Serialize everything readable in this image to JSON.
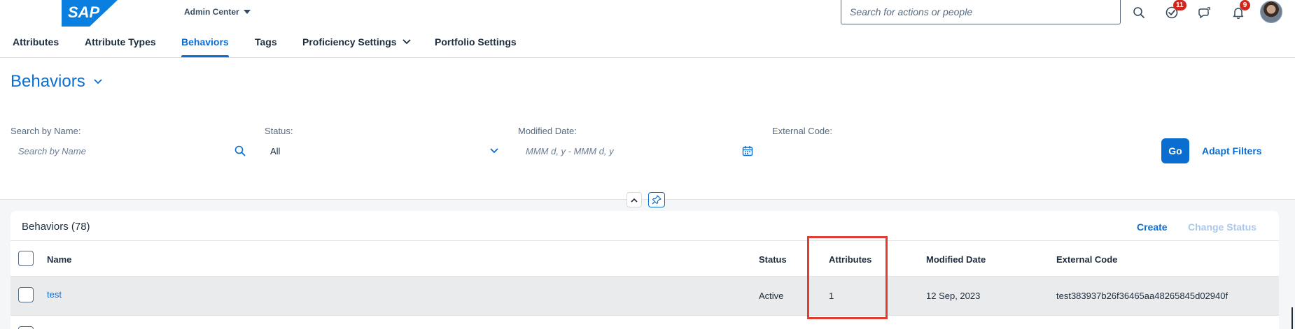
{
  "shell": {
    "logo_text": "SAP",
    "app_switcher_label": "Admin Center",
    "search_placeholder": "Search for actions or people",
    "badges": {
      "tasks": "11",
      "notifications": "9"
    }
  },
  "tabs": [
    {
      "label": "Attributes"
    },
    {
      "label": "Attribute Types"
    },
    {
      "label": "Behaviors"
    },
    {
      "label": "Tags"
    },
    {
      "label": "Proficiency Settings"
    },
    {
      "label": "Portfolio Settings"
    }
  ],
  "page": {
    "title": "Behaviors"
  },
  "filters": {
    "name": {
      "label": "Search by Name:",
      "placeholder": "Search by Name"
    },
    "status": {
      "label": "Status:",
      "value": "All"
    },
    "modified": {
      "label": "Modified Date:",
      "placeholder": "MMM d, y - MMM d, y"
    },
    "external": {
      "label": "External Code:"
    },
    "go_label": "Go",
    "adapt_label": "Adapt Filters"
  },
  "table": {
    "title": "Behaviors (78)",
    "create_label": "Create",
    "change_status_label": "Change Status",
    "columns": {
      "name": "Name",
      "status": "Status",
      "attributes": "Attributes",
      "modified": "Modified Date",
      "external": "External Code"
    },
    "rows": [
      {
        "name": "test",
        "status": "Active",
        "attributes": "1",
        "modified": "12 Sep, 2023",
        "external": "test383937b26f36465aa48265845d02940f"
      }
    ]
  },
  "colors": {
    "accent": "#0a6ed1",
    "highlight": "#e03c31",
    "badge": "#d0271d"
  }
}
